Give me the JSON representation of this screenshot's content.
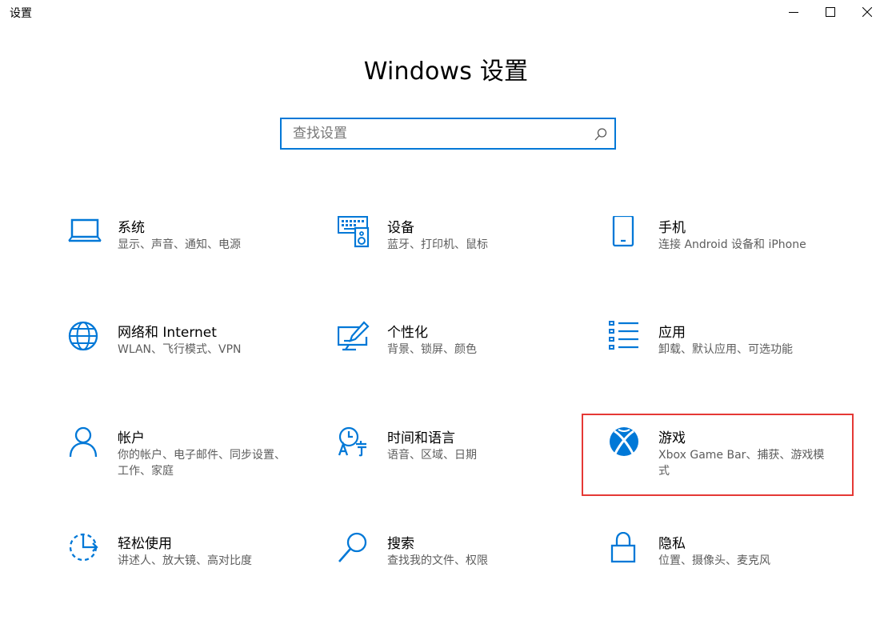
{
  "window": {
    "title": "设置"
  },
  "header": {
    "title": "Windows 设置"
  },
  "search": {
    "placeholder": "查找设置"
  },
  "tiles": [
    {
      "name": "系统",
      "desc": "显示、声音、通知、电源",
      "icon": "laptop-icon"
    },
    {
      "name": "设备",
      "desc": "蓝牙、打印机、鼠标",
      "icon": "devices-icon"
    },
    {
      "name": "手机",
      "desc": "连接 Android 设备和 iPhone",
      "icon": "phone-icon"
    },
    {
      "name": "网络和 Internet",
      "desc": "WLAN、飞行模式、VPN",
      "icon": "globe-icon"
    },
    {
      "name": "个性化",
      "desc": "背景、锁屏、颜色",
      "icon": "personalization-icon"
    },
    {
      "name": "应用",
      "desc": "卸载、默认应用、可选功能",
      "icon": "apps-list-icon"
    },
    {
      "name": "帐户",
      "desc": "你的帐户、电子邮件、同步设置、工作、家庭",
      "icon": "person-icon"
    },
    {
      "name": "时间和语言",
      "desc": "语音、区域、日期",
      "icon": "time-language-icon"
    },
    {
      "name": "游戏",
      "desc": "Xbox Game Bar、捕获、游戏模式",
      "icon": "xbox-icon"
    },
    {
      "name": "轻松使用",
      "desc": "讲述人、放大镜、高对比度",
      "icon": "ease-of-access-icon"
    },
    {
      "name": "搜索",
      "desc": "查找我的文件、权限",
      "icon": "search-icon"
    },
    {
      "name": "隐私",
      "desc": "位置、摄像头、麦克风",
      "icon": "lock-icon"
    }
  ],
  "colors": {
    "accent": "#0078d7",
    "highlight": "#e53935",
    "description": "#5d5d5d"
  }
}
